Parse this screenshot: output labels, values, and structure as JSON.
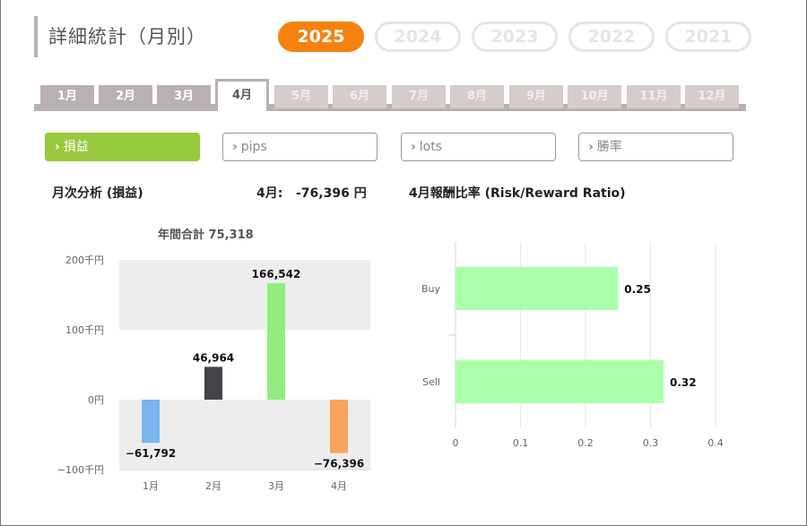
{
  "title": "詳細統計（月別）",
  "years": [
    "2025",
    "2024",
    "2023",
    "2022",
    "2021"
  ],
  "months": [
    "1月",
    "2月",
    "3月",
    "4月",
    "5月",
    "6月",
    "7月",
    "8月",
    "9月",
    "10月",
    "11月",
    "12月"
  ],
  "metrics": [
    "損益",
    "pips",
    "lots",
    "勝率"
  ],
  "analysis": {
    "label": "月次分析 (損益)",
    "current_month": "4月:",
    "current_value": "-76,396 円",
    "rr_title": "4月報酬比率 (Risk/Reward Ratio)",
    "annual_total": "年間合計 75,318"
  },
  "colors": {
    "accent": "#f5820f",
    "metric_active": "#97c93d",
    "tab": "#b9b1b1"
  },
  "chart_data": [
    {
      "type": "bar",
      "title": "年間合計 75,318",
      "categories": [
        "1月",
        "2月",
        "3月",
        "4月"
      ],
      "values": [
        -61792,
        46964,
        166542,
        -76396
      ],
      "value_labels": [
        "−61,792",
        "46,964",
        "166,542",
        "−76,396"
      ],
      "bar_colors": [
        "#7cb5ec",
        "#434348",
        "#90ed7d",
        "#f7a35c"
      ],
      "yticks": [
        "200千円",
        "100千円",
        "0円",
        "−100千円"
      ],
      "ylim": [
        -100000,
        200000
      ],
      "grid": false
    },
    {
      "type": "bar",
      "orientation": "horizontal",
      "title": "4月報酬比率 (Risk/Reward Ratio)",
      "categories": [
        "Buy",
        "Sell"
      ],
      "values": [
        0.25,
        0.32
      ],
      "value_labels": [
        "0.25",
        "0.32"
      ],
      "bar_color": "#aaffaa",
      "xticks": [
        "0",
        "0.1",
        "0.2",
        "0.3",
        "0.4"
      ],
      "xlim": [
        0,
        0.4
      ],
      "grid": true
    }
  ]
}
